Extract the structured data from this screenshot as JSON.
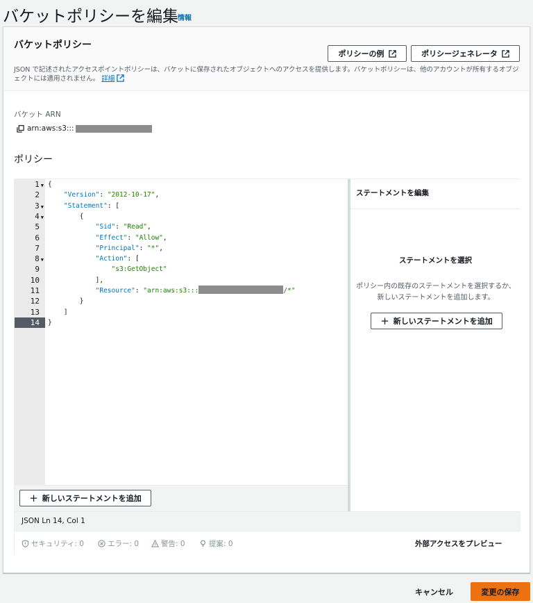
{
  "header": {
    "title": "バケットポリシーを編集",
    "info": "情報"
  },
  "section": {
    "title": "バケットポリシー",
    "description": "JSON で記述されたアクセスポイントポリシーは、バケットに保存されたオブジェクトへのアクセスを提供します。バケットポリシーは、他のアカウントが所有するオブジェクトには適用されません。",
    "details_link": "詳細",
    "policy_examples_button": "ポリシーの例",
    "policy_generator_button": "ポリシージェネレータ"
  },
  "arn": {
    "label": "バケット ARN",
    "prefix": "arn:aws:s3:::"
  },
  "policy": {
    "label": "ポリシー"
  },
  "editor": {
    "line_numbers": [
      "1",
      "2",
      "3",
      "4",
      "5",
      "6",
      "7",
      "8",
      "9",
      "10",
      "11",
      "12",
      "13",
      "14"
    ],
    "lines": [
      "{",
      "    \"Version\": \"2012-10-17\",",
      "    \"Statement\": [",
      "        {",
      "            \"Sid\": \"Read\",",
      "            \"Effect\": \"Allow\",",
      "            \"Principal\": \"*\",",
      "            \"Action\": [",
      "                \"s3:GetObject\"",
      "            ],",
      "            \"Resource\": \"arn:aws:s3:::",
      "        }",
      "    ]",
      "}"
    ],
    "resource_suffix": "/*\"",
    "add_statement_button": "新しいステートメントを追加",
    "status": "JSON   Ln 14, Col 1"
  },
  "statement_panel": {
    "title": "ステートメントを編集",
    "empty_title": "ステートメントを選択",
    "empty_description": "ポリシー内の既存のステートメントを選択するか、新しいステートメントを追加します。",
    "add_statement_button": "新しいステートメントを追加"
  },
  "lint": {
    "security": "セキュリティ: 0",
    "errors": "エラー: 0",
    "warnings": "警告: 0",
    "suggestions": "提案: 0",
    "preview_link": "外部アクセスをプレビュー"
  },
  "footer": {
    "cancel": "キャンセル",
    "save": "変更の保存"
  },
  "colors": {
    "accent": "#0073bb",
    "primary_button": "#ec7211",
    "string": "#1d8102",
    "key": "#0073bb"
  }
}
